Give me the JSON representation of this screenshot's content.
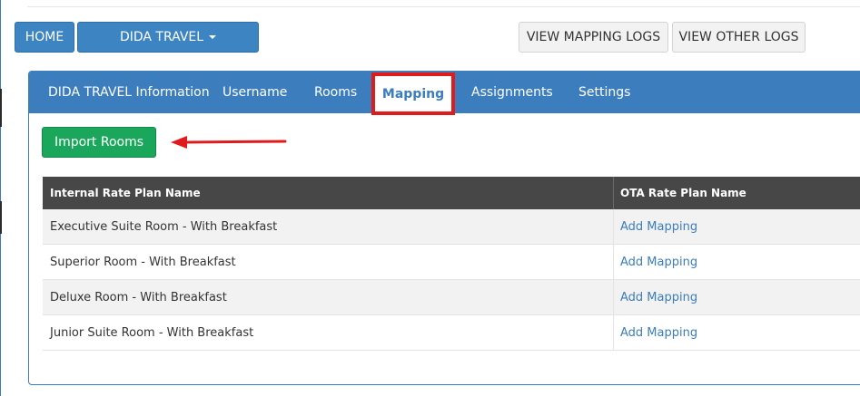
{
  "header": {
    "home_label": "HOME",
    "dida_label": "DIDA TRAVEL",
    "view_mapping_logs_label": "VIEW MAPPING LOGS",
    "view_other_logs_label": "VIEW OTHER LOGS"
  },
  "tabs": [
    {
      "label": "DIDA TRAVEL Information"
    },
    {
      "label": "Username"
    },
    {
      "label": "Rooms"
    },
    {
      "label": "Mapping",
      "active": true
    },
    {
      "label": "Assignments"
    },
    {
      "label": "Settings"
    }
  ],
  "actions": {
    "import_label": "Import Rooms"
  },
  "table": {
    "columns": [
      "Internal Rate Plan Name",
      "OTA Rate Plan Name"
    ],
    "rows": [
      {
        "name": "Executive Suite Room - With Breakfast",
        "action": "Add Mapping"
      },
      {
        "name": "Superior Room - With Breakfast",
        "action": "Add Mapping"
      },
      {
        "name": "Deluxe Room - With Breakfast",
        "action": "Add Mapping"
      },
      {
        "name": "Junior Suite Room - With Breakfast",
        "action": "Add Mapping"
      }
    ]
  },
  "colors": {
    "primary": "#3b7dbd",
    "success": "#1aa75b",
    "highlight": "#e01b1b",
    "table_header": "#474747"
  },
  "icons": {
    "dropdown": "caret-down-icon",
    "annotation": "red-arrow-icon"
  }
}
